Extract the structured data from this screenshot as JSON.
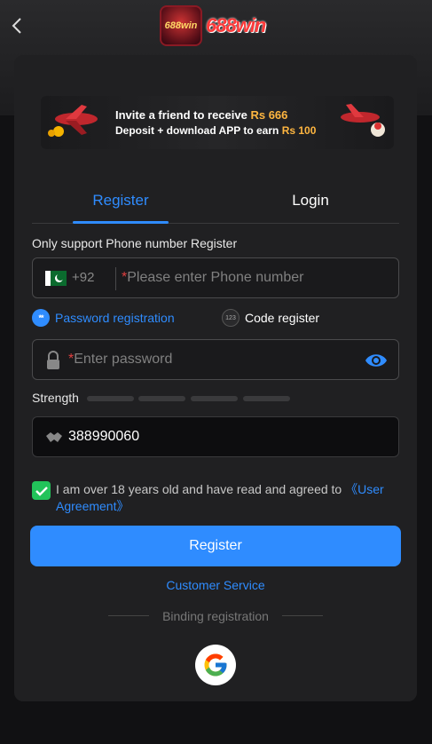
{
  "header": {
    "back_icon": "chevron-left-icon",
    "logo_badge_text": "688win",
    "logo_text": "688win"
  },
  "banner": {
    "line1_prefix": "Invite a friend to receive",
    "line1_amount": "Rs 666",
    "line2_prefix": "Deposit + download APP to earn",
    "line2_amount": "Rs 100",
    "amount_color": "#ffb640"
  },
  "tabs": {
    "register": "Register",
    "login": "Login"
  },
  "form": {
    "phone_support_label": "Only support Phone number Register",
    "country_code": "+92",
    "required_mark": "*",
    "phone_placeholder": "Please enter Phone number",
    "mode_password": "Password registration",
    "mode_password_icon_text": "**",
    "mode_code": "Code register",
    "mode_code_icon_text": "123",
    "password_placeholder": "Enter password",
    "strength_label": "Strength",
    "referral_code": "388990060",
    "agree_text": "I am over 18 years old and have read and agreed to ",
    "agree_link": "《User Agreement》",
    "register_button": "Register",
    "customer_service": "Customer Service",
    "binding_label": "Binding registration"
  },
  "colors": {
    "accent": "#2f8cff",
    "checkbox": "#22c35a",
    "required": "#e04040",
    "card_bg": "#202022"
  }
}
